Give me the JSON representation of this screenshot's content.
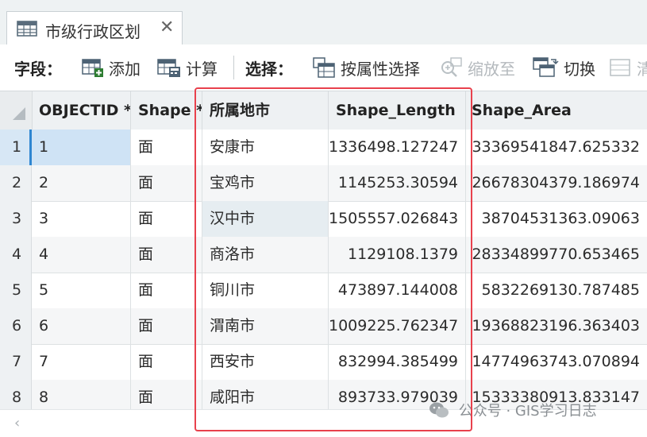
{
  "tab": {
    "title": "市级行政区划",
    "icon": "table-icon",
    "close_symbol": "✕"
  },
  "toolbar": {
    "field_label": "字段：",
    "add_label": "添加",
    "calculate_label": "计算",
    "select_label": "选择：",
    "select_by_attr_label": "按属性选择",
    "zoom_to_label": "缩放至",
    "switch_label": "切换",
    "clear_label": "清"
  },
  "table": {
    "columns": [
      "OBJECTID *",
      "Shape *",
      "所属地市",
      "Shape_Length",
      "Shape_Area"
    ],
    "rows": [
      {
        "row_num": "1",
        "objectid": "1",
        "shape": "面",
        "city": "安康市",
        "length": "1336498.127247",
        "area": "33369541847.625332"
      },
      {
        "row_num": "2",
        "objectid": "2",
        "shape": "面",
        "city": "宝鸡市",
        "length": "1145253.30594",
        "area": "26678304379.186974"
      },
      {
        "row_num": "3",
        "objectid": "3",
        "shape": "面",
        "city": "汉中市",
        "length": "1505557.026843",
        "area": "38704531363.09063"
      },
      {
        "row_num": "4",
        "objectid": "4",
        "shape": "面",
        "city": "商洛市",
        "length": "1129108.1379",
        "area": "28334899770.653465"
      },
      {
        "row_num": "5",
        "objectid": "5",
        "shape": "面",
        "city": "铜川市",
        "length": "473897.144008",
        "area": "5832269130.787485"
      },
      {
        "row_num": "6",
        "objectid": "6",
        "shape": "面",
        "city": "渭南市",
        "length": "1009225.762347",
        "area": "19368823196.363403"
      },
      {
        "row_num": "7",
        "objectid": "7",
        "shape": "面",
        "city": "西安市",
        "length": "832994.385499",
        "area": "14774963743.070894"
      },
      {
        "row_num": "8",
        "objectid": "8",
        "shape": "面",
        "city": "咸阳市",
        "length": "893733.979039",
        "area": "15333380913.833147"
      }
    ]
  },
  "watermark": "公众号 · GIS学习日志",
  "colors": {
    "highlight": "#e8414d",
    "selection": "#2e86d1"
  }
}
